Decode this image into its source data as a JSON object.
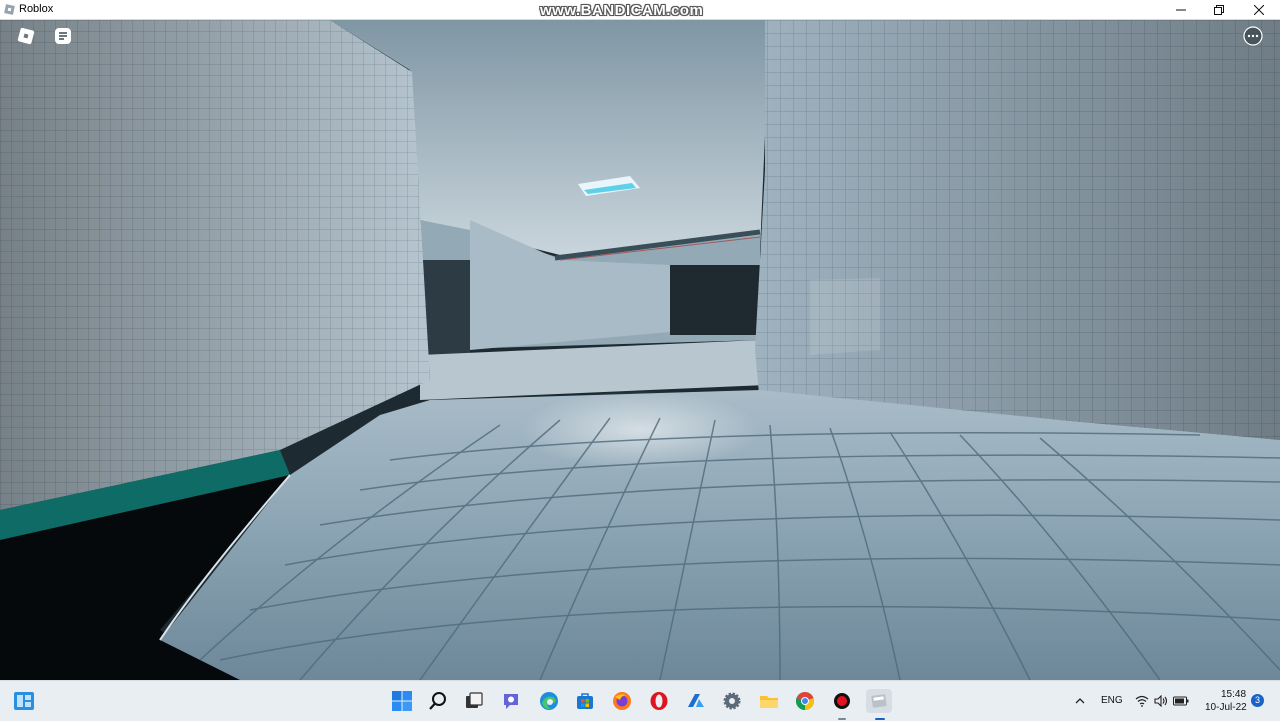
{
  "window": {
    "title": "Roblox",
    "watermark": "www.BANDICAM.com"
  },
  "game": {
    "overlay_buttons": [
      "roblox-menu",
      "chat",
      "more"
    ]
  },
  "taskbar": {
    "pinned_apps": [
      "start",
      "search",
      "task-view",
      "teams-chat",
      "edge",
      "microsoft-store",
      "firefox",
      "opera",
      "azure",
      "settings",
      "file-explorer",
      "chrome",
      "bandicam",
      "roblox"
    ],
    "language": "ENG",
    "time": "15:48",
    "date": "10-Jul-22",
    "notification_count": "3"
  },
  "colors": {
    "tile": "#8aa4b6",
    "wall": "#b8c6cf",
    "teal_trim": "#0f6b66",
    "taskbar_bg": "#e9eef3"
  }
}
